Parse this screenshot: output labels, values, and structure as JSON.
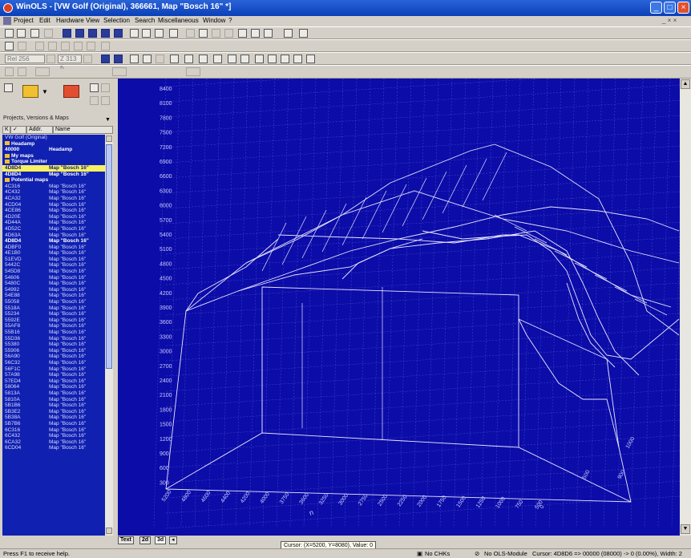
{
  "window": {
    "title": "WinOLS - [VW Golf (Original), 366661, Map \"Bosch 16\" *]"
  },
  "menu": {
    "items": [
      "Project",
      "Edit",
      "Hardware",
      "View",
      "Selection",
      "Search",
      "Miscellaneous",
      "Window",
      "?"
    ],
    "right": "_ × ×"
  },
  "toolbar": {
    "combo_a": "Rel 256",
    "combo_b": "Z 313 K"
  },
  "panel": {
    "title": "Projects, Versions & Maps",
    "col_addr": "Addr.",
    "col_name": "Name",
    "col_k": "K",
    "col_v": "✓"
  },
  "tree": [
    {
      "kind": "plain",
      "c1": "VW Golf (Original)",
      "c2": ""
    },
    {
      "kind": "folder",
      "c1": "Headamp",
      "c2": ""
    },
    {
      "kind": "bold",
      "c1": "40000",
      "c2": "Headamp"
    },
    {
      "kind": "folder",
      "c1": "My maps",
      "c2": ""
    },
    {
      "kind": "folder",
      "c1": "Torque Limiter",
      "c2": ""
    },
    {
      "kind": "sel",
      "c1": "4D8D4",
      "c2": "Map \"Bosch 16\""
    },
    {
      "kind": "bold",
      "c1": "4D8D4",
      "c2": "Map \"Bosch 16\""
    },
    {
      "kind": "folder",
      "c1": "Potential maps",
      "c2": ""
    },
    {
      "kind": "plain",
      "c1": "4C316",
      "c2": "Map \"Bosch 16\""
    },
    {
      "kind": "plain",
      "c1": "4C432",
      "c2": "Map \"Bosch 16\""
    },
    {
      "kind": "plain",
      "c1": "4CA32",
      "c2": "Map \"Bosch 16\""
    },
    {
      "kind": "plain",
      "c1": "4CD04",
      "c2": "Map \"Bosch 16\""
    },
    {
      "kind": "plain",
      "c1": "4CE86",
      "c2": "Map \"Bosch 16\""
    },
    {
      "kind": "plain",
      "c1": "4D20E",
      "c2": "Map \"Bosch 16\""
    },
    {
      "kind": "plain",
      "c1": "4D44A",
      "c2": "Map \"Bosch 16\""
    },
    {
      "kind": "plain",
      "c1": "4D52C",
      "c2": "Map \"Bosch 16\""
    },
    {
      "kind": "plain",
      "c1": "4D63A",
      "c2": "Map \"Bosch 16\""
    },
    {
      "kind": "bold",
      "c1": "4D8D4",
      "c2": "Map \"Bosch 16\""
    },
    {
      "kind": "plain",
      "c1": "4DBF0",
      "c2": "Map \"Bosch 16\""
    },
    {
      "kind": "plain",
      "c1": "4E1B0",
      "c2": "Map \"Bosch 16\""
    },
    {
      "kind": "plain",
      "c1": "51EVD",
      "c2": "Map \"Bosch 16\""
    },
    {
      "kind": "plain",
      "c1": "5442C",
      "c2": "Map \"Bosch 16\""
    },
    {
      "kind": "plain",
      "c1": "545D8",
      "c2": "Map \"Bosch 16\""
    },
    {
      "kind": "plain",
      "c1": "54606",
      "c2": "Map \"Bosch 16\""
    },
    {
      "kind": "plain",
      "c1": "5480C",
      "c2": "Map \"Bosch 16\""
    },
    {
      "kind": "plain",
      "c1": "54992",
      "c2": "Map \"Bosch 16\""
    },
    {
      "kind": "plain",
      "c1": "54E88",
      "c2": "Map \"Bosch 16\""
    },
    {
      "kind": "plain",
      "c1": "55058",
      "c2": "Map \"Bosch 16\""
    },
    {
      "kind": "plain",
      "c1": "5518A",
      "c2": "Map \"Bosch 16\""
    },
    {
      "kind": "plain",
      "c1": "55234",
      "c2": "Map \"Bosch 16\""
    },
    {
      "kind": "plain",
      "c1": "5592E",
      "c2": "Map \"Bosch 16\""
    },
    {
      "kind": "plain",
      "c1": "55AF8",
      "c2": "Map \"Bosch 16\""
    },
    {
      "kind": "plain",
      "c1": "55B16",
      "c2": "Map \"Bosch 16\""
    },
    {
      "kind": "plain",
      "c1": "55D36",
      "c2": "Map \"Bosch 16\""
    },
    {
      "kind": "plain",
      "c1": "55380",
      "c2": "Map \"Bosch 16\""
    },
    {
      "kind": "plain",
      "c1": "55906",
      "c2": "Map \"Bosch 16\""
    },
    {
      "kind": "plain",
      "c1": "56A90",
      "c2": "Map \"Bosch 16\""
    },
    {
      "kind": "plain",
      "c1": "56C32",
      "c2": "Map \"Bosch 16\""
    },
    {
      "kind": "plain",
      "c1": "56F1C",
      "c2": "Map \"Bosch 16\""
    },
    {
      "kind": "plain",
      "c1": "57A98",
      "c2": "Map \"Bosch 16\""
    },
    {
      "kind": "plain",
      "c1": "57ED4",
      "c2": "Map \"Bosch 16\""
    },
    {
      "kind": "plain",
      "c1": "58064",
      "c2": "Map \"Bosch 16\""
    },
    {
      "kind": "plain",
      "c1": "5813A",
      "c2": "Map \"Bosch 16\""
    },
    {
      "kind": "plain",
      "c1": "5810A",
      "c2": "Map \"Bosch 16\""
    },
    {
      "kind": "plain",
      "c1": "5B1B6",
      "c2": "Map \"Bosch 16\""
    },
    {
      "kind": "plain",
      "c1": "5B3E2",
      "c2": "Map \"Bosch 16\""
    },
    {
      "kind": "plain",
      "c1": "5B38A",
      "c2": "Map \"Bosch 16\""
    },
    {
      "kind": "plain",
      "c1": "5B7B6",
      "c2": "Map \"Bosch 16\""
    },
    {
      "kind": "plain",
      "c1": "6C316",
      "c2": "Map \"Bosch 16\""
    },
    {
      "kind": "plain",
      "c1": "6C432",
      "c2": "Map \"Bosch 16\""
    },
    {
      "kind": "plain",
      "c1": "6CA32",
      "c2": "Map \"Bosch 16\""
    },
    {
      "kind": "plain",
      "c1": "6CD04",
      "c2": "Map \"Bosch 16\""
    }
  ],
  "chart": {
    "y_ticks": [
      "8400",
      "8100",
      "7800",
      "7500",
      "7200",
      "6900",
      "6600",
      "6300",
      "6000",
      "5700",
      "5400",
      "5100",
      "4800",
      "4500",
      "4200",
      "3900",
      "3600",
      "3300",
      "3000",
      "2700",
      "2400",
      "2100",
      "1800",
      "1500",
      "1200",
      "900",
      "600",
      "300"
    ],
    "x_ticks": [
      "5200",
      "4800",
      "4600",
      "4400",
      "4200",
      "4000",
      "3750",
      "3600",
      "3250",
      "3000",
      "2750",
      "2500",
      "2250",
      "2000",
      "1750",
      "1500",
      "1250",
      "1000",
      "750",
      "500"
    ],
    "z_ticks": [
      "1000",
      "900",
      "500",
      "0"
    ],
    "axis_label": "n"
  },
  "tabs": [
    "Text",
    "2d",
    "3d"
  ],
  "cursor_info": "Cursor: (X=5200, Y=8080), Value: 0",
  "status": {
    "help": "Press F1 to receive help.",
    "chk": "No CHKs",
    "module": "No OLS-Module",
    "cursor": "Cursor: 4D8D6 => 00000 (08000) -> 0 (0.00%), Width: 2"
  }
}
